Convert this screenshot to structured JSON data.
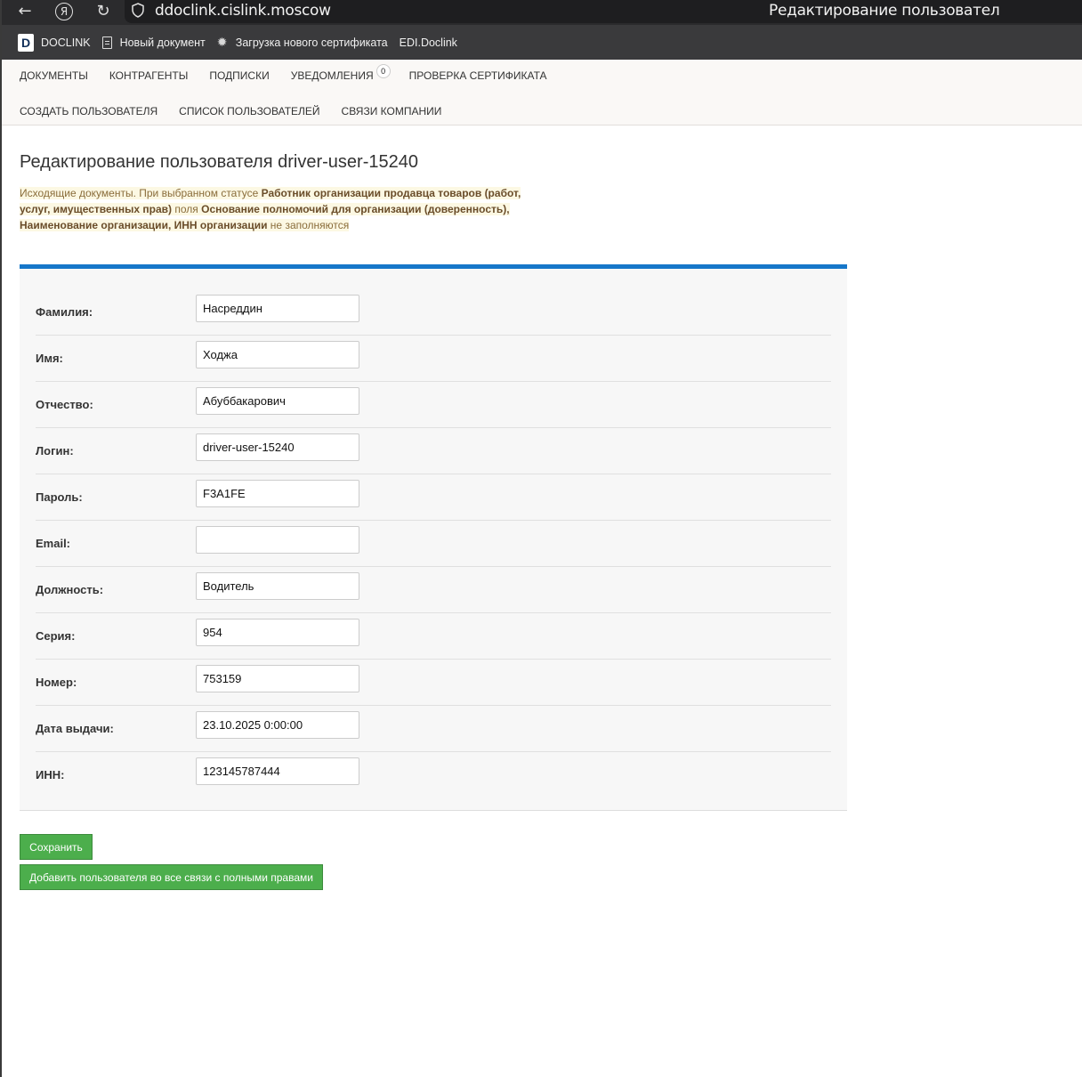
{
  "browser": {
    "url": "ddoclink.cislink.moscow",
    "tab_title": "Редактирование пользовател",
    "yandex_glyph": "Я"
  },
  "bookmarks": [
    {
      "label": "DOCLINK",
      "logo": "D",
      "icon": "doclink-logo"
    },
    {
      "label": "Новый документ",
      "icon": "document-icon"
    },
    {
      "label": "Загрузка нового сертификата",
      "icon": "gear-icon"
    },
    {
      "label": "EDI.Doclink",
      "icon": ""
    }
  ],
  "nav": {
    "row1": [
      {
        "label": "ДОКУМЕНТЫ"
      },
      {
        "label": "КОНТРАГЕНТЫ"
      },
      {
        "label": "ПОДПИСКИ"
      },
      {
        "label": "УВЕДОМЛЕНИЯ",
        "badge": "0"
      },
      {
        "label": "ПРОВЕРКА СЕРТИФИКАТА"
      }
    ],
    "row2": [
      {
        "label": "СОЗДАТЬ ПОЛЬЗОВАТЕЛЯ"
      },
      {
        "label": "СПИСОК ПОЛЬЗОВАТЕЛЕЙ"
      },
      {
        "label": "СВЯЗИ КОМПАНИИ"
      }
    ]
  },
  "page": {
    "title": "Редактирование пользователя driver-user-15240",
    "notice": {
      "part1": "Исходящие документы. При выбранном статусе ",
      "bold1": "Работник организации продавца товаров (работ, услуг, имущественных прав)",
      "part2": " поля ",
      "bold2": "Основание полномочий для организации (доверенность), Наименование организации, ИНН организации",
      "part3": " не заполняются"
    }
  },
  "form": {
    "fields": [
      {
        "label": "Фамилия:",
        "value": "Насреддин"
      },
      {
        "label": "Имя:",
        "value": "Ходжа"
      },
      {
        "label": "Отчество:",
        "value": "Абуббакарович"
      },
      {
        "label": "Логин:",
        "value": "driver-user-15240"
      },
      {
        "label": "Пароль:",
        "value": "F3A1FE"
      },
      {
        "label": "Email:",
        "value": ""
      },
      {
        "label": "Должность:",
        "value": "Водитель"
      },
      {
        "label": "Серия:",
        "value": "954"
      },
      {
        "label": "Номер:",
        "value": "753159"
      },
      {
        "label": "Дата выдачи:",
        "value": "23.10.2025 0:00:00"
      },
      {
        "label": "ИНН:",
        "value": "123145787444"
      }
    ]
  },
  "buttons": {
    "save": "Сохранить",
    "add_to_all": "Добавить пользователя во все связи с полными правами"
  },
  "colors": {
    "accent": "#1677c9",
    "button_green": "#4cae4c",
    "notice_text": "#8a6d3b"
  }
}
